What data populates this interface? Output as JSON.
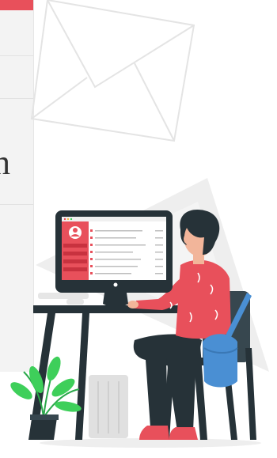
{
  "illustration": {
    "subject": "person-working-at-computer",
    "colors": {
      "accent": "#e8505b",
      "accent_dark": "#c8323f",
      "bag": "#4a8fd3",
      "pants": "#263238",
      "chair": "#37474f",
      "plant": "#3ecf5a",
      "hair": "#263238",
      "skin": "#f2b59a",
      "decor": "#e6e6e6"
    }
  },
  "partial_panel": {
    "glyph": "n"
  }
}
